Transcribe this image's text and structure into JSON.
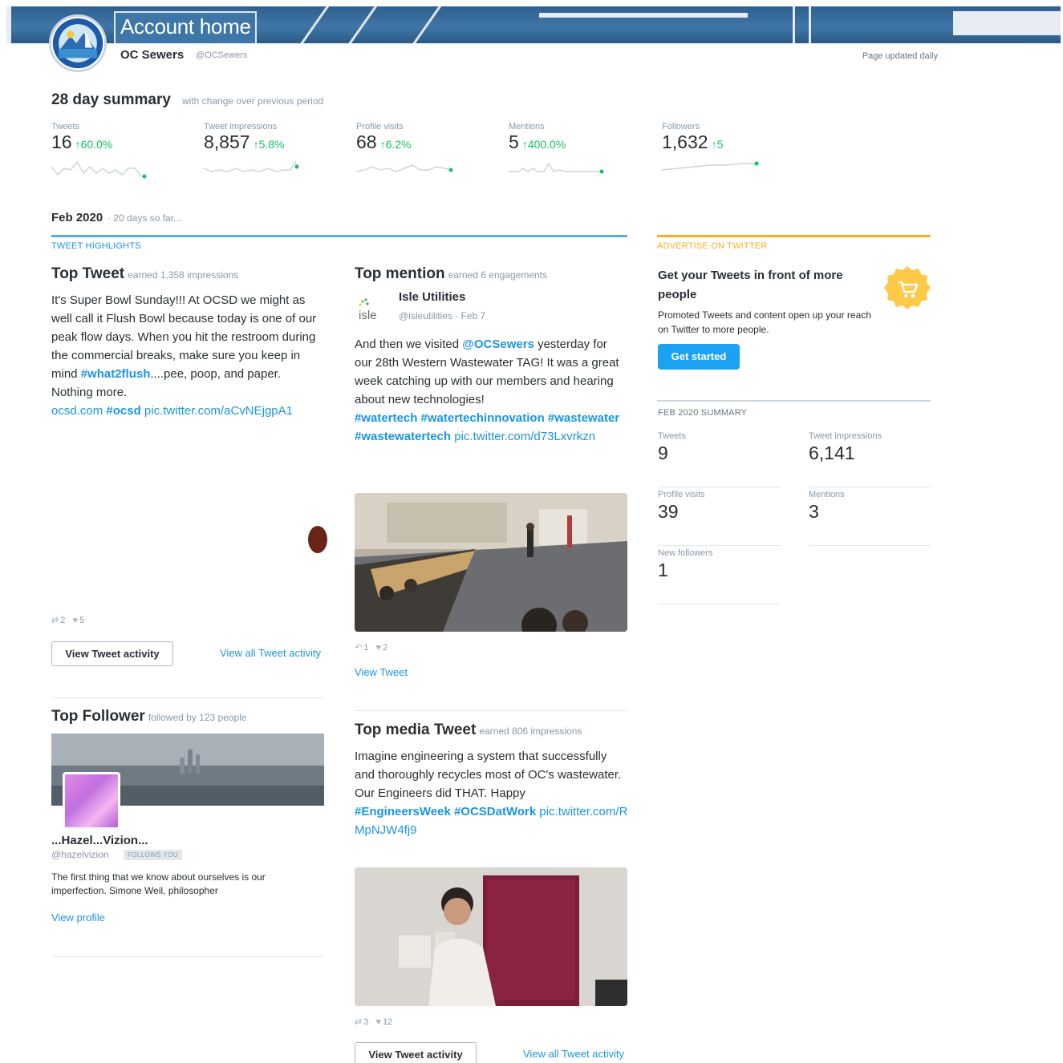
{
  "header": {
    "title": "Account home",
    "account_name": "OC Sewers",
    "account_handle": "@OCSewers",
    "page_updated": "Page updated daily"
  },
  "summary": {
    "title": "28 day summary",
    "subtitle": "with change over previous period",
    "metrics": [
      {
        "label": "Tweets",
        "value": "16",
        "change": "60.0%"
      },
      {
        "label": "Tweet impressions",
        "value": "8,857",
        "change": "5.8%"
      },
      {
        "label": "Profile visits",
        "value": "68",
        "change": "6.2%"
      },
      {
        "label": "Mentions",
        "value": "5",
        "change": "400.0%"
      },
      {
        "label": "Followers",
        "value": "1,632",
        "change": "5"
      }
    ],
    "up_color": "#17bf63"
  },
  "month": {
    "title": "Feb 2020",
    "subtitle": "· 20 days so far..."
  },
  "highlights": {
    "label": "TWEET HIGHLIGHTS",
    "top_tweet": {
      "title": "Top Tweet",
      "subtitle": "earned 1,358 impressions",
      "text_1": "It's Super Bowl Sunday!!! At OCSD we might as well call it Flush Bowl because today is one of our peak flow days. When you hit the restroom during the commercial breaks, make sure you keep in mind",
      "hashtag_1": "#what2flush",
      "text_2": "....pee, poop, and paper. Nothing more.",
      "link_1": "ocsd.com",
      "hashtag_2": "#ocsd",
      "link_2": "pic.twitter.com/aCvNEjgpA1",
      "retweets": "2",
      "likes": "5",
      "view_button": "View Tweet activity",
      "view_all": "View all Tweet activity"
    },
    "top_mention": {
      "title": "Top mention",
      "subtitle": "earned 6 engagements",
      "author_name": "Isle Utilities",
      "author_meta": "@isleutilities · Feb 7",
      "avatar_text": "isle",
      "text_1": "And then we visited",
      "mention": "@OCSewers",
      "text_2": "yesterday for our 28th Western Wastewater TAG! It was a great week catching up with our members and hearing about new technologies!",
      "hashtags": "#watertech #watertechinnovation #wastewater #wastewatertech",
      "link": "pic.twitter.com/d73Lxvrkzn",
      "replies": "1",
      "likes": "2",
      "view_link": "View Tweet"
    },
    "top_follower": {
      "title": "Top Follower",
      "subtitle": "followed by 123 people",
      "name": "...Hazel...Vizion...",
      "handle": "@hazelvizion",
      "badge": "FOLLOWS YOU",
      "bio": "The first thing that we know about ourselves is our imperfection. Simone Weil,  philosopher",
      "view_profile": "View profile"
    },
    "top_media_tweet": {
      "title": "Top media Tweet",
      "subtitle": "earned 806 impressions",
      "text_1": "Imagine engineering a system that successfully and thoroughly recycles most of OC's wastewater. Our Engineers did THAT. Happy",
      "hashtags": "#EngineersWeek #OCSDatWork",
      "link": "pic.twitter.com/RMpNJW4fj9",
      "retweets": "3",
      "likes": "12",
      "view_button": "View Tweet activity",
      "view_all": "View all Tweet activity"
    }
  },
  "advertise": {
    "label": "ADVERTISE ON TWITTER",
    "title": "Get your Tweets in front of more people",
    "body": "Promoted Tweets and content open up your reach on Twitter to more people.",
    "button": "Get started",
    "accent": "#ffad1f"
  },
  "month_summary": {
    "label": "FEB 2020 SUMMARY",
    "items": [
      {
        "label": "Tweets",
        "value": "9"
      },
      {
        "label": "Tweet impressions",
        "value": "6,141"
      },
      {
        "label": "Profile visits",
        "value": "39"
      },
      {
        "label": "Mentions",
        "value": "3"
      },
      {
        "label": "New followers",
        "value": "1"
      }
    ]
  }
}
